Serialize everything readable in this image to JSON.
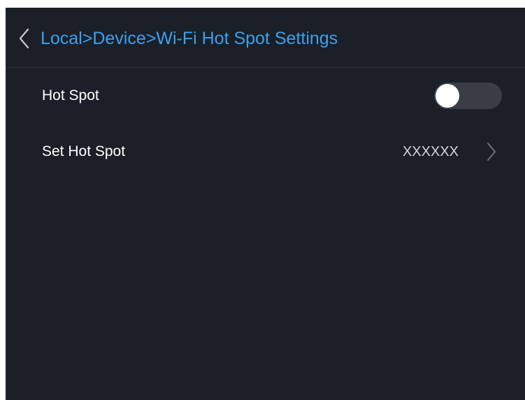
{
  "header": {
    "title": "Local>Device>Wi-Fi Hot Spot Settings",
    "back_icon": "chevron-left-icon"
  },
  "settings": {
    "hot_spot": {
      "label": "Hot Spot",
      "enabled": false
    },
    "set_hot_spot": {
      "label": "Set Hot Spot",
      "value": "XXXXXX",
      "icon": "chevron-right-icon"
    }
  },
  "colors": {
    "background": "#1b1f27",
    "accent": "#3ba0ef",
    "divider": "#30353f",
    "toggle_track_off": "#3a3d45",
    "toggle_knob": "#ffffff",
    "text_primary": "#ffffff",
    "text_secondary": "#d2d4d8"
  }
}
